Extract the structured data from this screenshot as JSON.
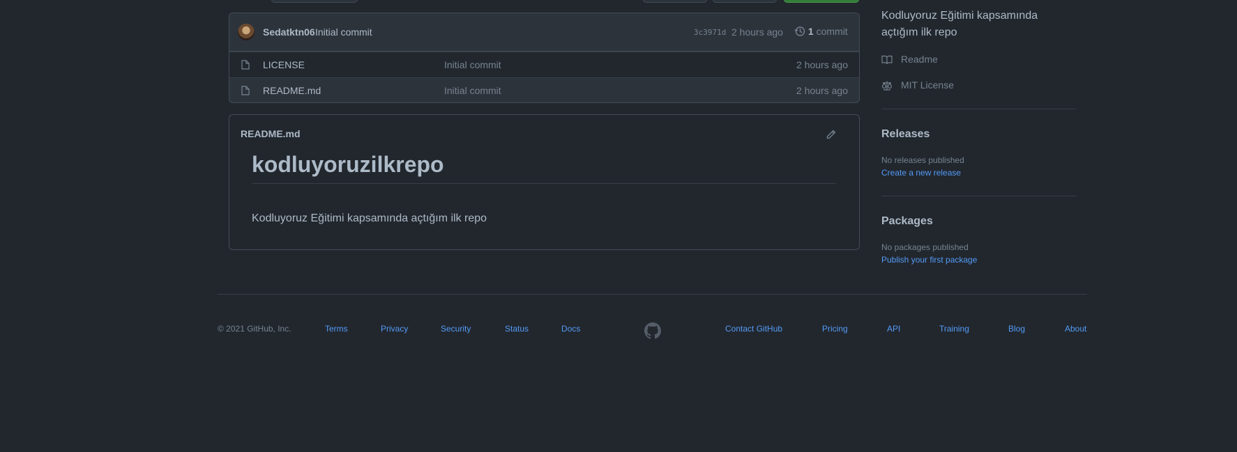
{
  "commit": {
    "author": "Sedatktn06",
    "message": "Initial commit",
    "sha": "3c3971d",
    "time": "2 hours ago",
    "count": "1",
    "count_label": "commit"
  },
  "files": [
    {
      "name": "LICENSE",
      "message": "Initial commit",
      "age": "2 hours ago"
    },
    {
      "name": "README.md",
      "message": "Initial commit",
      "age": "2 hours ago"
    }
  ],
  "readme": {
    "file_title": "README.md",
    "heading": "kodluyoruzilkrepo",
    "body": "Kodluyoruz Eğitimi kapsamında açtığım ilk repo"
  },
  "sidebar": {
    "about": "Kodluyoruz Eğitimi kapsamında açtığım ilk repo",
    "readme_link": "Readme",
    "license_link": "MIT License",
    "releases": {
      "title": "Releases",
      "empty": "No releases published",
      "link": "Create a new release"
    },
    "packages": {
      "title": "Packages",
      "empty": "No packages published",
      "link": "Publish your first package"
    }
  },
  "footer": {
    "copyright": "© 2021 GitHub, Inc.",
    "left_links": [
      "Terms",
      "Privacy",
      "Security",
      "Status",
      "Docs"
    ],
    "right_links": [
      "Contact GitHub",
      "Pricing",
      "API",
      "Training",
      "Blog",
      "About"
    ]
  },
  "colors": {
    "background": "#22272e",
    "link": "#539bf5",
    "text": "#adbac7",
    "muted": "#768390",
    "border": "#444c56"
  },
  "icons": [
    "file-icon",
    "history-icon",
    "pencil-icon",
    "book-icon",
    "law-icon",
    "github-logo-icon"
  ]
}
